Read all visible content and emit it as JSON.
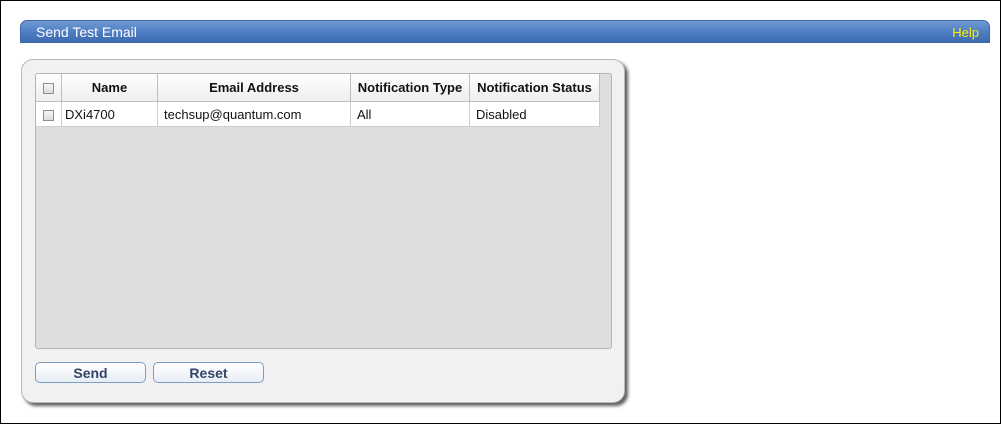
{
  "header": {
    "title": "Send Test Email",
    "help": "Help"
  },
  "table": {
    "columns": [
      "Name",
      "Email Address",
      "Notification Type",
      "Notification Status"
    ],
    "rows": [
      {
        "name": "DXi4700",
        "email": "techsup@quantum.com",
        "type": "All",
        "status": "Disabled"
      }
    ]
  },
  "buttons": {
    "send": "Send",
    "reset": "Reset"
  }
}
